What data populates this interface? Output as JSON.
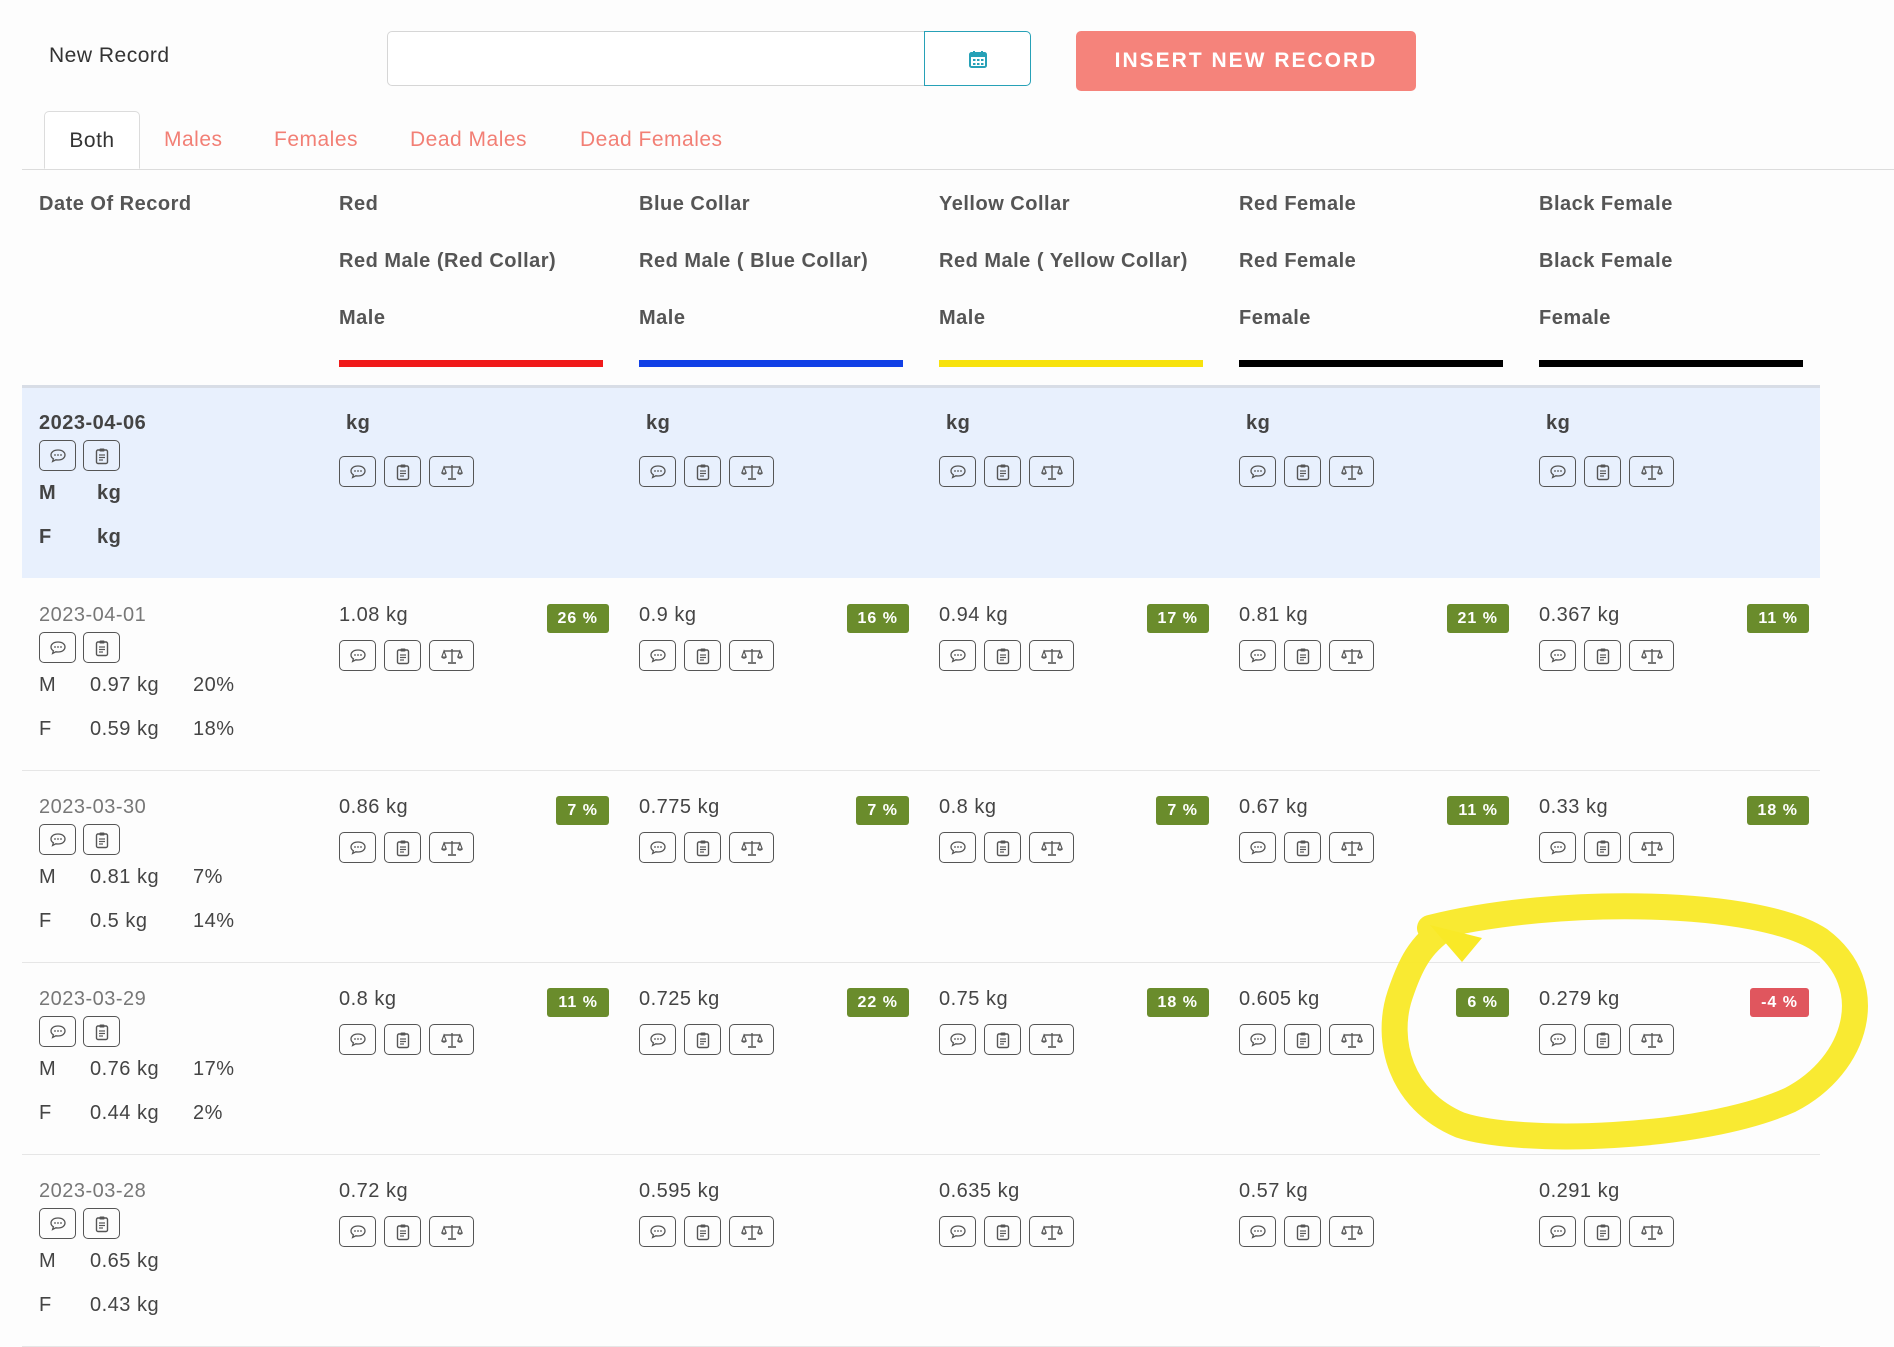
{
  "toolbar": {
    "new_record_label": "New Record",
    "date_value": "",
    "calendar_icon": "calendar-icon",
    "insert_button": "INSERT NEW RECORD"
  },
  "tabs": [
    "Both",
    "Males",
    "Females",
    "Dead Males",
    "Dead Females"
  ],
  "active_tab": "Both",
  "table": {
    "date_header": "Date Of Record",
    "columns": [
      {
        "name": "Red",
        "sub": "Red Male (Red Collar)",
        "sex": "Male",
        "color": "#f01a1a"
      },
      {
        "name": "Blue Collar",
        "sub": "Red Male ( Blue Collar)",
        "sex": "Male",
        "color": "#1140e6"
      },
      {
        "name": "Yellow Collar",
        "sub": "Red Male ( Yellow Collar)",
        "sex": "Male",
        "color": "#f7e20d"
      },
      {
        "name": "Red Female",
        "sub": "Red Female",
        "sex": "Female",
        "color": "#000000"
      },
      {
        "name": "Black Female",
        "sub": "Black Female",
        "sex": "Female",
        "color": "#000000"
      }
    ],
    "rows": [
      {
        "date": "2023-04-06",
        "m_label": "M",
        "m_value": "kg",
        "m_pct": "",
        "f_label": "F",
        "f_value": "kg",
        "f_pct": "",
        "cells": [
          {
            "value": "kg",
            "badge": ""
          },
          {
            "value": "kg",
            "badge": ""
          },
          {
            "value": "kg",
            "badge": ""
          },
          {
            "value": "kg",
            "badge": ""
          },
          {
            "value": "kg",
            "badge": ""
          }
        ]
      },
      {
        "date": "2023-04-01",
        "m_label": "M",
        "m_value": "0.97 kg",
        "m_pct": "20%",
        "f_label": "F",
        "f_value": "0.59 kg",
        "f_pct": "18%",
        "cells": [
          {
            "value": "1.08 kg",
            "badge": "26 %"
          },
          {
            "value": "0.9 kg",
            "badge": "16 %"
          },
          {
            "value": "0.94 kg",
            "badge": "17 %"
          },
          {
            "value": "0.81 kg",
            "badge": "21 %"
          },
          {
            "value": "0.367 kg",
            "badge": "11 %"
          }
        ]
      },
      {
        "date": "2023-03-30",
        "m_label": "M",
        "m_value": "0.81 kg",
        "m_pct": "7%",
        "f_label": "F",
        "f_value": "0.5 kg",
        "f_pct": "14%",
        "cells": [
          {
            "value": "0.86 kg",
            "badge": "7 %"
          },
          {
            "value": "0.775 kg",
            "badge": "7 %"
          },
          {
            "value": "0.8 kg",
            "badge": "7 %"
          },
          {
            "value": "0.67 kg",
            "badge": "11 %"
          },
          {
            "value": "0.33 kg",
            "badge": "18 %"
          }
        ]
      },
      {
        "date": "2023-03-29",
        "m_label": "M",
        "m_value": "0.76 kg",
        "m_pct": "17%",
        "f_label": "F",
        "f_value": "0.44 kg",
        "f_pct": "2%",
        "cells": [
          {
            "value": "0.8 kg",
            "badge": "11 %"
          },
          {
            "value": "0.725 kg",
            "badge": "22 %"
          },
          {
            "value": "0.75 kg",
            "badge": "18 %"
          },
          {
            "value": "0.605 kg",
            "badge": "6 %"
          },
          {
            "value": "0.279 kg",
            "badge": "-4 %"
          }
        ]
      },
      {
        "date": "2023-03-28",
        "m_label": "M",
        "m_value": "0.65 kg",
        "m_pct": "",
        "f_label": "F",
        "f_value": "0.43 kg",
        "f_pct": "",
        "cells": [
          {
            "value": "0.72 kg",
            "badge": ""
          },
          {
            "value": "0.595 kg",
            "badge": ""
          },
          {
            "value": "0.635 kg",
            "badge": ""
          },
          {
            "value": "0.57 kg",
            "badge": ""
          },
          {
            "value": "0.291 kg",
            "badge": ""
          }
        ]
      }
    ]
  },
  "icons": {
    "comment": "comment-icon",
    "clipboard": "clipboard-icon",
    "scale": "scale-icon"
  },
  "colors": {
    "accent": "#f5837b",
    "positive_badge": "#6a8c2c",
    "negative_badge": "#e0565e",
    "highlight_row": "#e8f0fd",
    "annotation": "#f9e927"
  }
}
